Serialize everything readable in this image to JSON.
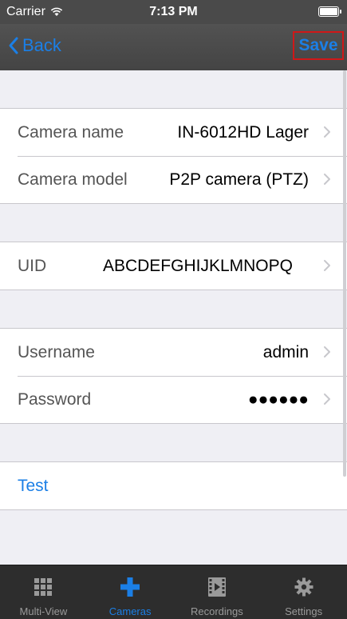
{
  "status_bar": {
    "carrier": "Carrier",
    "time": "7:13 PM"
  },
  "nav": {
    "back_label": "Back",
    "save_label": "Save"
  },
  "camera_section": [
    {
      "label": "Camera name",
      "value": "IN-6012HD Lager"
    },
    {
      "label": "Camera model",
      "value": "P2P camera (PTZ)"
    }
  ],
  "uid_section": {
    "label": "UID",
    "value": "ABCDEFGHIJKLMNOPQ"
  },
  "credentials_section": [
    {
      "label": "Username",
      "value": "admin"
    },
    {
      "label": "Password",
      "value": "●●●●●●"
    }
  ],
  "test_section": {
    "label": "Test"
  },
  "tab_bar": {
    "tabs": [
      {
        "label": "Multi-View",
        "icon": "grid-icon",
        "active": false
      },
      {
        "label": "Cameras",
        "icon": "plus-icon",
        "active": true
      },
      {
        "label": "Recordings",
        "icon": "film-icon",
        "active": false
      },
      {
        "label": "Settings",
        "icon": "gear-icon",
        "active": false
      }
    ]
  },
  "colors": {
    "accent": "#1b7fe6",
    "nav_bar": "#4a4a4a",
    "tab_bar": "#2d2d2d",
    "save_highlight": "#d01818"
  }
}
